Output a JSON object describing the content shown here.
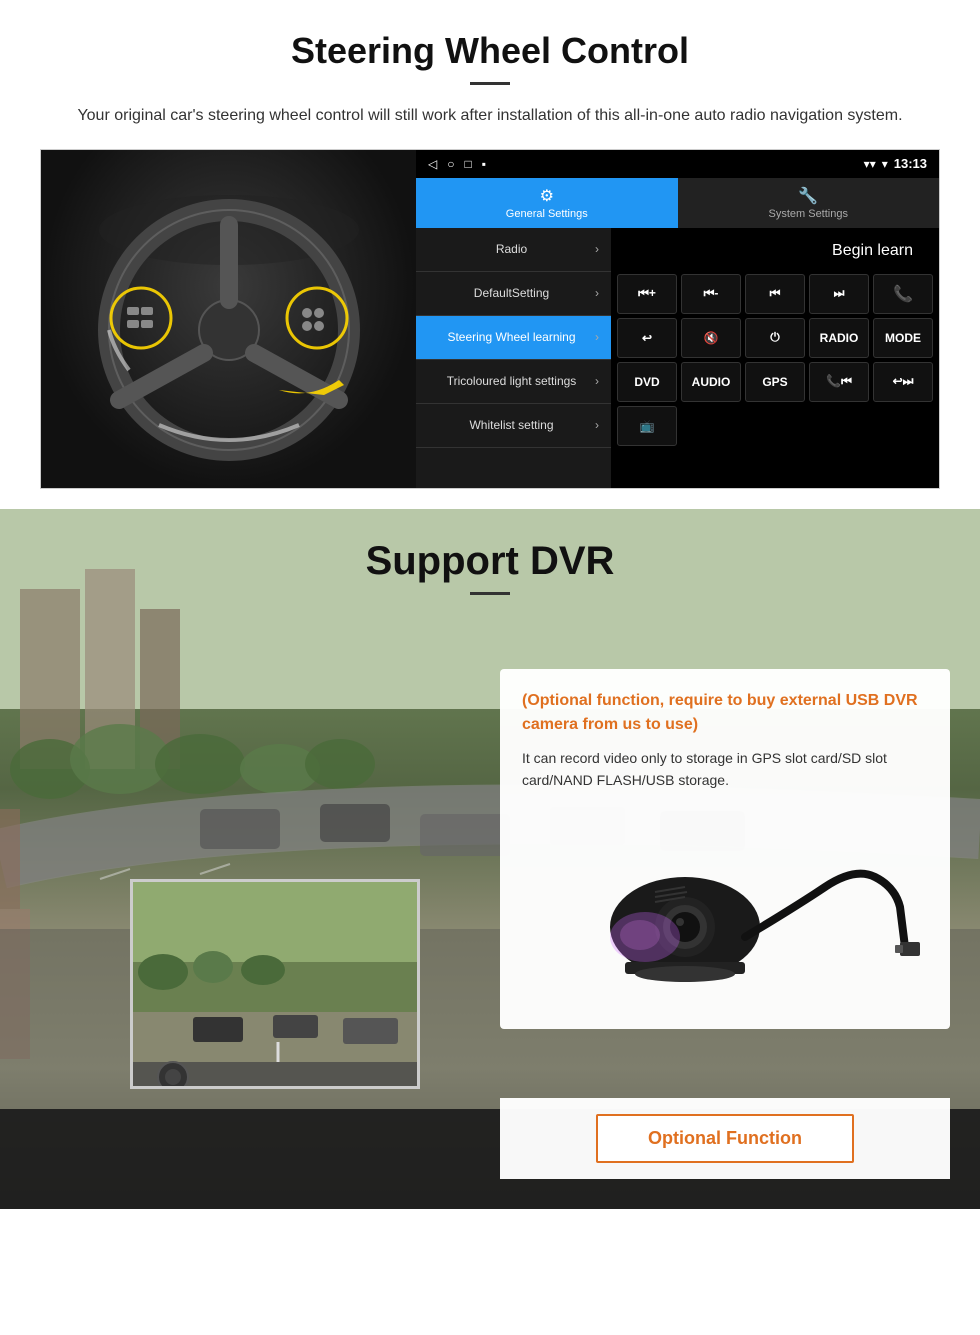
{
  "steering_section": {
    "title": "Steering Wheel Control",
    "subtitle": "Your original car's steering wheel control will still work after installation of this all-in-one auto radio navigation system.",
    "status_bar": {
      "time": "13:13",
      "nav_icon": "◁",
      "home_icon": "○",
      "square_icon": "□",
      "menu_icon": "▪"
    },
    "tabs": [
      {
        "label": "General Settings",
        "active": true
      },
      {
        "label": "System Settings",
        "active": false
      }
    ],
    "menu_items": [
      {
        "label": "Radio",
        "active": false
      },
      {
        "label": "DefaultSetting",
        "active": false
      },
      {
        "label": "Steering Wheel learning",
        "active": true
      },
      {
        "label": "Tricoloured light settings",
        "active": false
      },
      {
        "label": "Whitelist setting",
        "active": false
      }
    ],
    "begin_learn_label": "Begin learn",
    "controls": [
      [
        "⏮+",
        "⏮-",
        "⏮⏮",
        "⏭⏭",
        "📞"
      ],
      [
        "↩",
        "🔇×",
        "⏻",
        "RADIO",
        "MODE"
      ],
      [
        "DVD",
        "AUDIO",
        "GPS",
        "📞⏮",
        "↩⏭"
      ]
    ],
    "extra_btn_label": "📺"
  },
  "dvr_section": {
    "title": "Support DVR",
    "info_orange": "(Optional function, require to buy external USB DVR camera from us to use)",
    "info_text": "It can record video only to storage in GPS slot card/SD slot card/NAND FLASH/USB storage.",
    "optional_function_label": "Optional Function"
  }
}
